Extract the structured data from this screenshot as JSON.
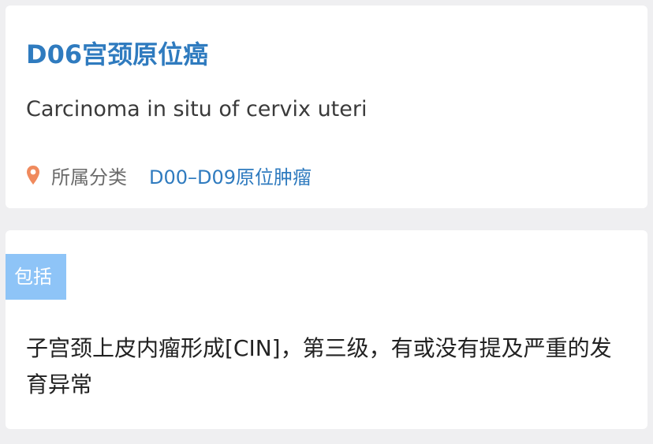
{
  "entry": {
    "title": "D06宫颈原位癌",
    "english_name": "Carcinoma in situ of cervix uteri",
    "category": {
      "icon": "location-pin-icon",
      "label": "所属分类",
      "value": "D00–D09原位肿瘤"
    }
  },
  "includes": {
    "tag": "包括",
    "text": "子宫颈上皮内瘤形成[CIN]，第三级，有或没有提及严重的发育异常"
  },
  "colors": {
    "accent": "#2f7bbf",
    "pin": "#f08a5d",
    "tag_bg": "#8ec4f7",
    "page_bg": "#efeff1"
  }
}
